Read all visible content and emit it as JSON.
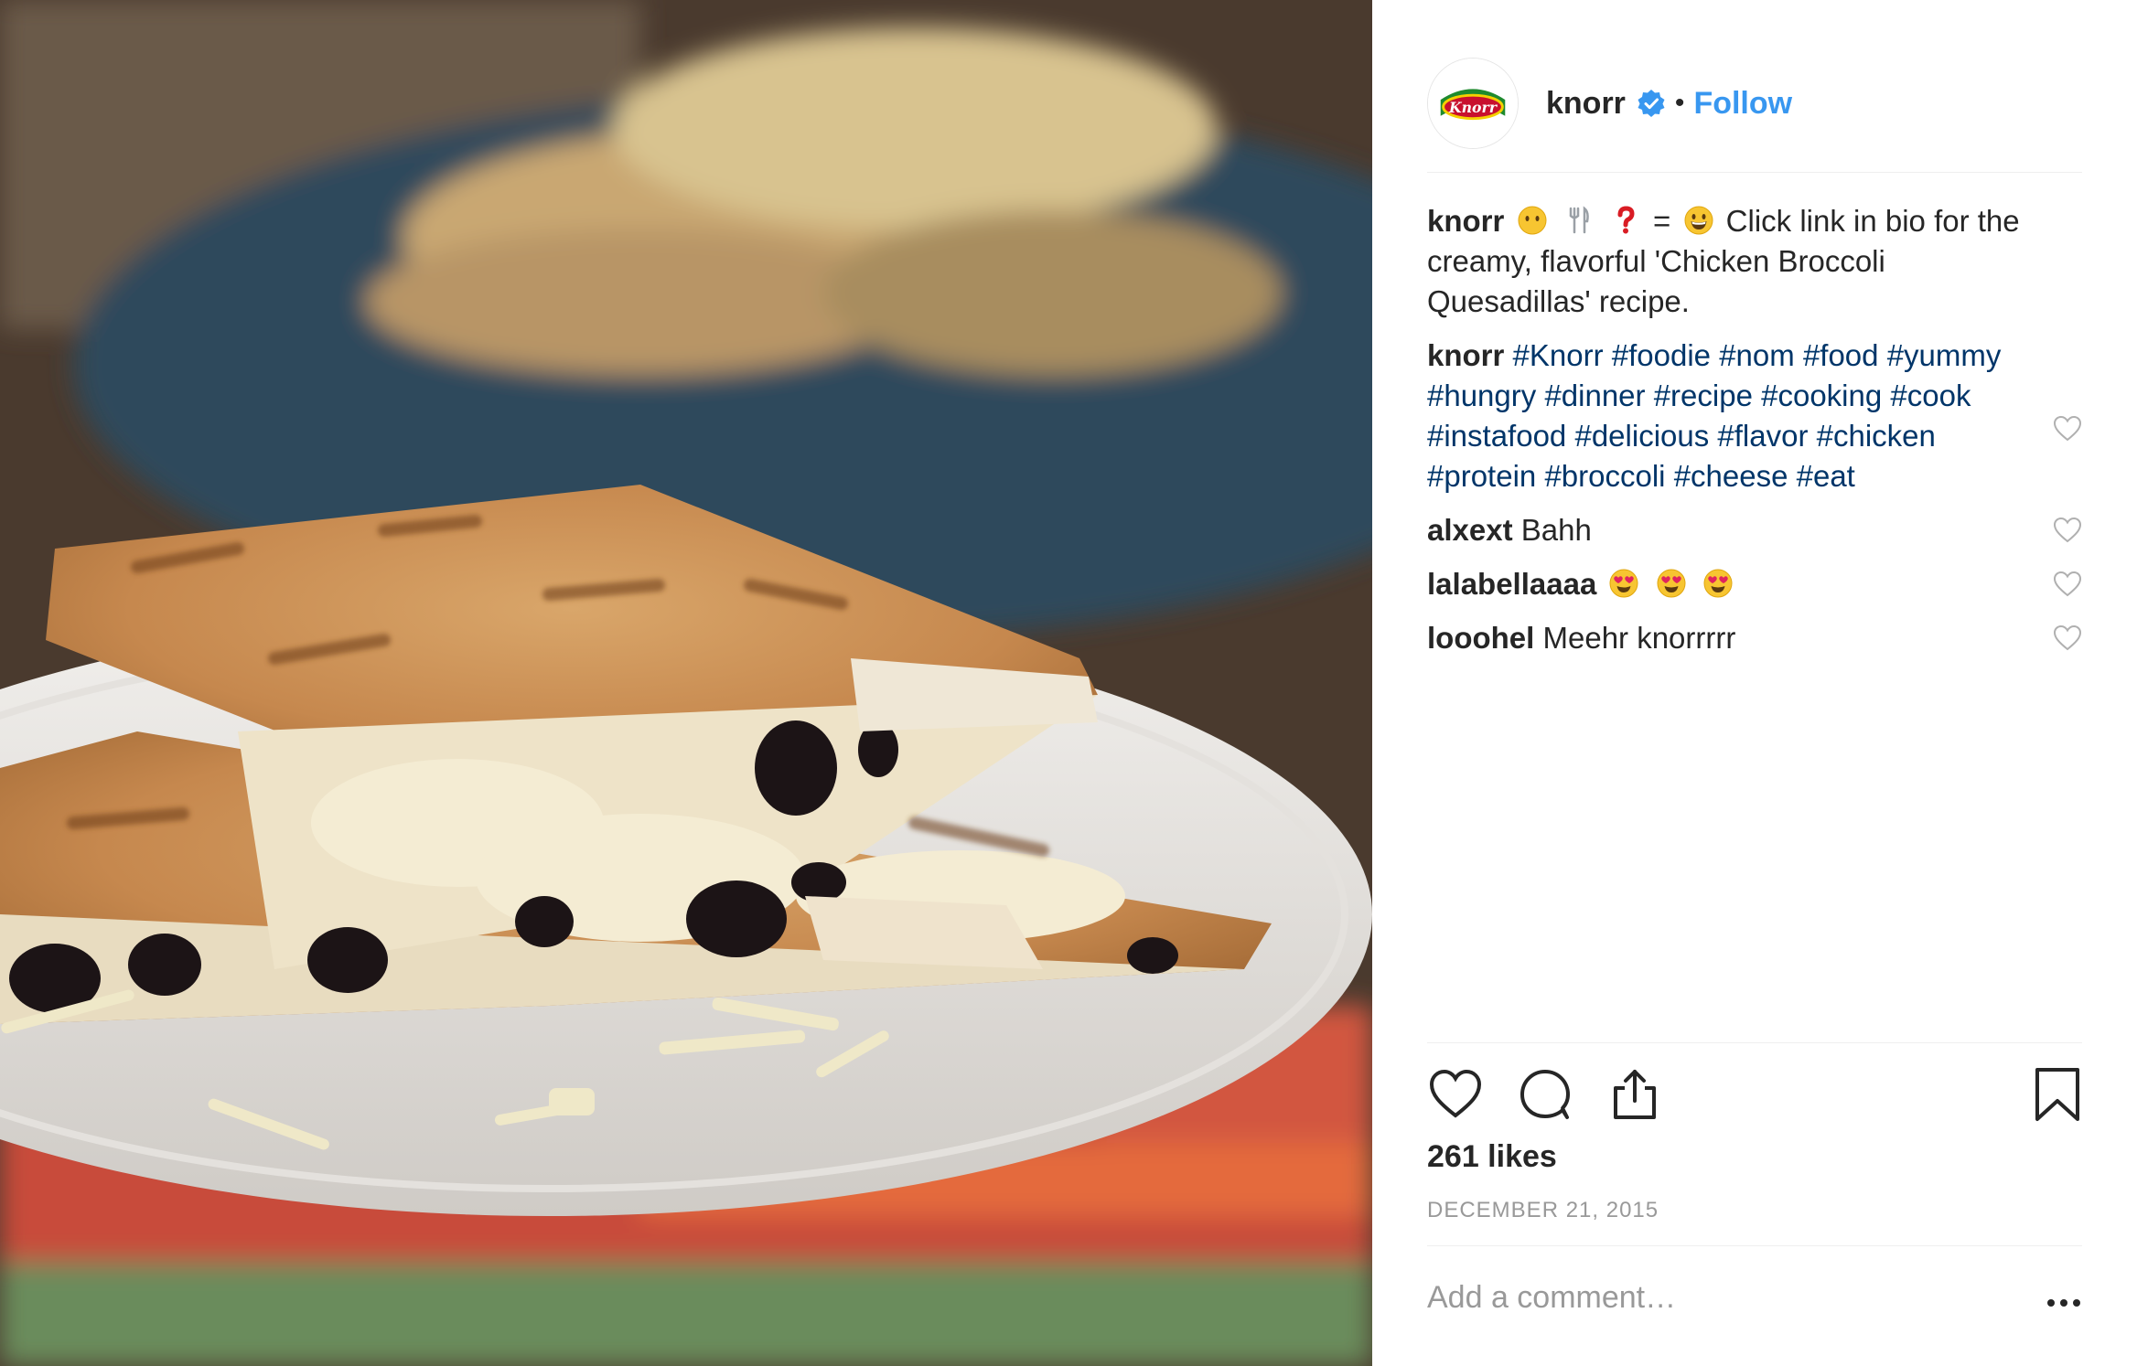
{
  "post": {
    "image_alt": "Chicken Broccoli Quesadillas on a plate",
    "account": {
      "username": "knorr",
      "avatar_label": "Knorr",
      "follow_label": "Follow",
      "separator": "•"
    },
    "caption": {
      "username": "knorr",
      "text": "Click link in bio for the creamy, flavorful 'Chicken Broccoli Quesadillas' recipe.",
      "emoji_sequence": [
        "face-without-mouth-emoji",
        "fork-and-knife-emoji",
        "red-question-mark-emoji",
        "equals-sign",
        "grinning-face-emoji"
      ],
      "equals": "="
    },
    "comments": [
      {
        "username": "knorr",
        "hashtags": [
          "#Knorr",
          "#foodie",
          "#nom",
          "#food",
          "#yummy",
          "#hungry",
          "#dinner",
          "#recipe",
          "#cooking",
          "#cook",
          "#instafood",
          "#delicious",
          "#flavor",
          "#chicken",
          "#protein",
          "#broccoli",
          "#cheese",
          "#eat"
        ]
      },
      {
        "username": "alxext",
        "text": "Bahh"
      },
      {
        "username": "lalabellaaaa",
        "text": "",
        "emoji": [
          "heart-eyes-emoji",
          "heart-eyes-emoji",
          "heart-eyes-emoji"
        ]
      },
      {
        "username": "looohel",
        "text": "Meehr knorrrrr"
      }
    ],
    "likes": "261 likes",
    "date": "DECEMBER 21, 2015",
    "add_comment_placeholder": "Add a comment…",
    "colors": {
      "link_blue": "#3897f0",
      "hashtag_blue": "#003569",
      "text": "#262626",
      "muted": "#999999",
      "divider": "#efefef"
    }
  }
}
